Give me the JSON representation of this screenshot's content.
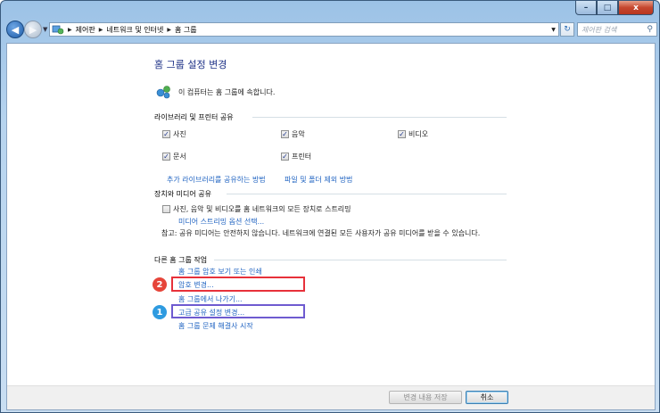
{
  "window": {
    "caption": {
      "minimize": "–",
      "maximize": "□",
      "close": "x"
    }
  },
  "address_bar": {
    "crumbs": [
      "제어판",
      "네트워크 및 인터넷",
      "홈 그룹"
    ],
    "separator": "▶",
    "search_placeholder": "제어판 검색"
  },
  "page": {
    "title": "홈 그룹 설정 변경",
    "membership_text": "이 컴퓨터는 홈 그룹에 속합니다.",
    "libraries_heading": "라이브러리 및 프린터 공유",
    "libraries": [
      {
        "label": "사진",
        "checked": true
      },
      {
        "label": "음악",
        "checked": true
      },
      {
        "label": "비디오",
        "checked": true
      },
      {
        "label": "문서",
        "checked": true
      },
      {
        "label": "프린터",
        "checked": true
      }
    ],
    "link_how_share": "추가 라이브러리를 공유하는 방법",
    "link_exclude": "파일 및 폴더 제외 방법",
    "media_heading": "장치와 미디어 공유",
    "media_checkbox": {
      "label": "사진, 음악 및 비디오를 홈 네트워크의 모든 장치로 스트리밍",
      "checked": false
    },
    "link_media_options": "미디어 스트리밍 옵션 선택...",
    "note": "참고: 공유 미디어는 안전하지 않습니다. 네트워크에 연결된 모든 사용자가 공유 미디어를 받을 수 있습니다.",
    "other_heading": "다른 홈 그룹 작업",
    "tasks": {
      "view_password": "홈 그룹 암호 보기 또는 인쇄",
      "change_password": "암호 변경...",
      "leave": "홈 그룹에서 나가기...",
      "advanced": "고급 공유 설정 변경...",
      "troubleshoot": "홈 그룹 문제 해결사 시작"
    },
    "badges": {
      "change_password": "2",
      "advanced": "1"
    }
  },
  "footer": {
    "save_label": "변경 내용 저장",
    "cancel_label": "취소"
  },
  "colors": {
    "title": "#1e3287",
    "link": "#2164c2",
    "highlight_red": "#e7313a",
    "highlight_purple": "#6e5bd0",
    "badge_red": "#e6453a",
    "badge_blue": "#2e9be0"
  }
}
